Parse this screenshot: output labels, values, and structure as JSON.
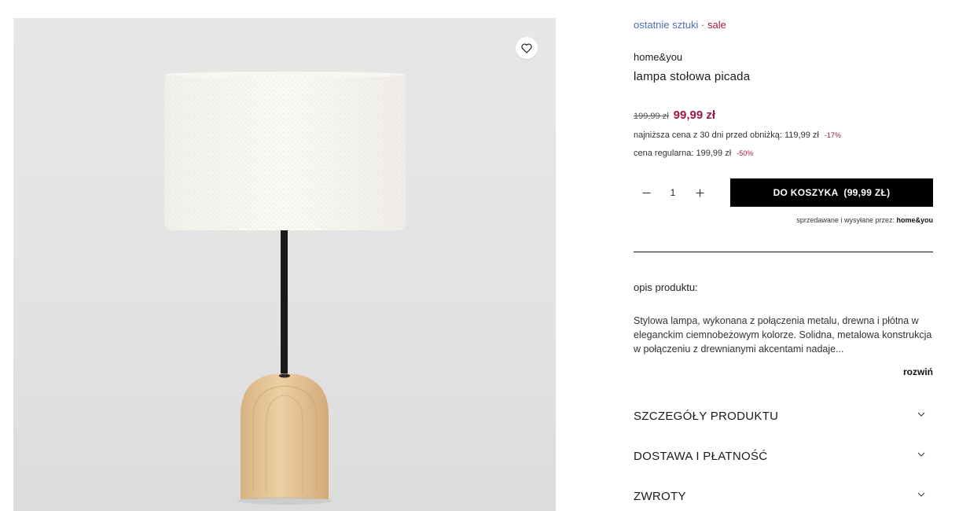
{
  "gallery": {
    "favorite_icon": "heart-outline-icon"
  },
  "product": {
    "tag_last": "ostatnie sztuki",
    "tag_separator": "·",
    "tag_sale": "sale",
    "brand": "home&you",
    "name": "lampa stołowa picada",
    "old_price": "199,99 zł",
    "new_price": "99,99 zł",
    "lowest_price_text": "najniższa cena z 30 dni przed obniżką: 119,99 zł",
    "lowest_price_discount": "-17%",
    "regular_price_text": "cena regularna: 199,99 zł",
    "regular_price_discount": "-50%",
    "price_color": "#a0174a",
    "link_color": "#4a6fb0"
  },
  "purchase": {
    "quantity": "1",
    "minus_icon": "minus-icon",
    "plus_icon": "plus-icon",
    "cart_label": "DO KOSZYKA  (99,99 ZŁ)",
    "seller_prefix": "sprzedawane i wysyłane przez:",
    "seller_name": "home&you"
  },
  "description": {
    "title": "opis produktu:",
    "text": "Stylowa lampa, wykonana z połączenia metalu, drewna i płótna w eleganckim ciemnobeżowym kolorze. Solidna, metalowa konstrukcja w połączeniu z drewnianymi akcentami nadaje...",
    "expand_label": "rozwiń"
  },
  "accordion": [
    {
      "label": "SZCZEGÓŁY PRODUKTU",
      "icon": "chevron-down-icon"
    },
    {
      "label": "DOSTAWA I PŁATNOŚĆ",
      "icon": "chevron-down-icon"
    },
    {
      "label": "ZWROTY",
      "icon": "chevron-down-icon"
    }
  ]
}
